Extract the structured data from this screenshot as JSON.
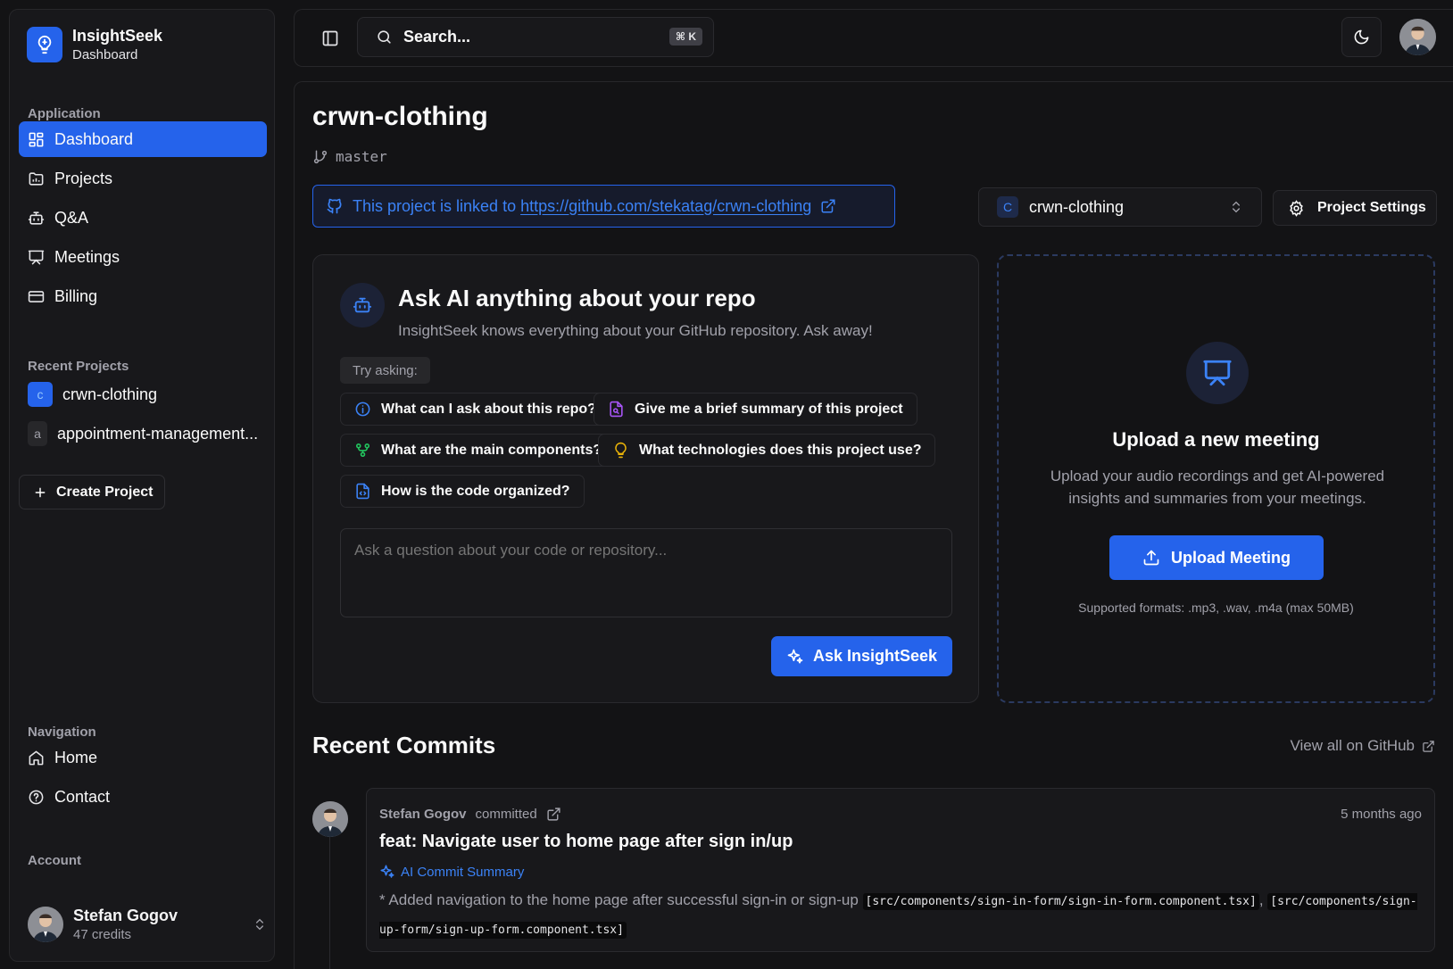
{
  "brand": {
    "name": "InsightSeek",
    "subtitle": "Dashboard"
  },
  "sidebar": {
    "application_label": "Application",
    "items": [
      {
        "label": "Dashboard",
        "icon": "layout-grid-icon",
        "active": true
      },
      {
        "label": "Projects",
        "icon": "folder-icon"
      },
      {
        "label": "Q&A",
        "icon": "bot-icon"
      },
      {
        "label": "Meetings",
        "icon": "presentation-icon"
      },
      {
        "label": "Billing",
        "icon": "credit-card-icon"
      }
    ],
    "recent_label": "Recent Projects",
    "recent_projects": [
      {
        "badge": "c",
        "name": "crwn-clothing"
      },
      {
        "badge": "a",
        "name": "appointment-management..."
      }
    ],
    "create_project": "Create Project",
    "navigation_label": "Navigation",
    "navigation": [
      {
        "label": "Home",
        "icon": "home-icon"
      },
      {
        "label": "Contact",
        "icon": "help-circle-icon"
      }
    ],
    "account_label": "Account",
    "user": {
      "name": "Stefan Gogov",
      "credits": "47 credits"
    }
  },
  "topbar": {
    "search_placeholder": "Search...",
    "shortcut": "⌘ K"
  },
  "project": {
    "name": "crwn-clothing",
    "branch": "master",
    "link_prefix": "This project is linked to ",
    "link_url": "https://github.com/stekatag/crwn-clothing",
    "selector_badge": "C",
    "selector_value": "crwn-clothing",
    "settings_label": "Project Settings"
  },
  "ask": {
    "title": "Ask AI anything about your repo",
    "subtitle": "InsightSeek knows everything about your GitHub repository. Ask away!",
    "try_label": "Try asking:",
    "suggestions": [
      {
        "label": "What can I ask about this repo?",
        "icon": "info-icon",
        "color": "#3b82f6"
      },
      {
        "label": "Give me a brief summary of this project",
        "icon": "file-search-icon",
        "color": "#a855f7"
      },
      {
        "label": "What are the main components?",
        "icon": "git-fork-icon",
        "color": "#22c55e"
      },
      {
        "label": "What technologies does this project use?",
        "icon": "lightbulb-icon",
        "color": "#eab308"
      },
      {
        "label": "How is the code organized?",
        "icon": "file-code-icon",
        "color": "#3b82f6"
      }
    ],
    "input_placeholder": "Ask a question about your code or repository...",
    "button": "Ask InsightSeek"
  },
  "upload": {
    "title": "Upload a new meeting",
    "description": "Upload your audio recordings and get AI-powered insights and summaries from your meetings.",
    "button": "Upload Meeting",
    "formats": "Supported formats: .mp3, .wav, .m4a (max 50MB)"
  },
  "commits": {
    "title": "Recent Commits",
    "view_all": "View all on GitHub",
    "items": [
      {
        "author": "Stefan Gogov",
        "action": "committed",
        "time": "5 months ago",
        "message": "feat: Navigate user to home page after sign in/up",
        "ai_label": "AI Commit Summary",
        "summary_text": "* Added navigation to the home page after successful sign-in or sign-up ",
        "file1": "[src/components/sign-in-form/sign-in-form.component.tsx]",
        "separator": ", ",
        "file2": "[src/components/sign-up-form/sign-up-form.component.tsx]"
      }
    ]
  },
  "colors": {
    "accent": "#2563eb",
    "background": "#131315",
    "card": "#18181b",
    "border": "#2a2a2e"
  }
}
